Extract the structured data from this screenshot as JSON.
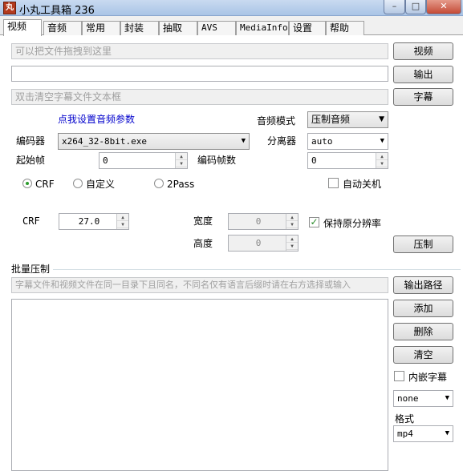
{
  "window": {
    "title": "小丸工具箱 236",
    "icon_text": "丸",
    "min": "–",
    "max": "□",
    "close": "✕"
  },
  "tabs": [
    "视频",
    "音频",
    "常用",
    "封装",
    "抽取",
    "AVS",
    "MediaInfo",
    "设置",
    "帮助"
  ],
  "video": {
    "video_drop_placeholder": "可以把文件拖拽到这里",
    "output_path": "",
    "subtitle_placeholder": "双击清空字幕文件文本框",
    "video_button": "视频",
    "output_button": "输出",
    "subtitle_button": "字幕",
    "audio_params_link": "点我设置音频参数",
    "audio_mode_label": "音频模式",
    "audio_mode_value": "压制音频",
    "encoder_label": "编码器",
    "encoder_value": "x264_32-8bit.exe",
    "demuxer_label": "分离器",
    "demuxer_value": "auto",
    "start_frame_label": "起始帧",
    "start_frame_value": "0",
    "encode_frames_label": "编码帧数",
    "encode_frames_value": "0",
    "mode_crf": "CRF",
    "mode_custom": "自定义",
    "mode_2pass": "2Pass",
    "auto_shutdown": "自动关机",
    "crf_label": "CRF",
    "crf_value": "27.0",
    "width_label": "宽度",
    "width_value": "0",
    "height_label": "高度",
    "height_value": "0",
    "keep_resolution": "保持原分辨率",
    "encode_button": "压制"
  },
  "batch": {
    "group_title": "批量压制",
    "hint_placeholder": "字幕文件和视频文件在同一目录下且同名，不同名仅有语言后缀时请在右方选择或输入",
    "output_path_button": "输出路径",
    "add_button": "添加",
    "delete_button": "删除",
    "clear_button": "清空",
    "embed_subtitle": "内嵌字幕",
    "subtitle_lang_value": "none",
    "format_label": "格式",
    "format_value": "mp4"
  },
  "icons": {
    "dropdown": "▼",
    "spin_up": "▲",
    "spin_down": "▼",
    "checkmark": "✓"
  }
}
